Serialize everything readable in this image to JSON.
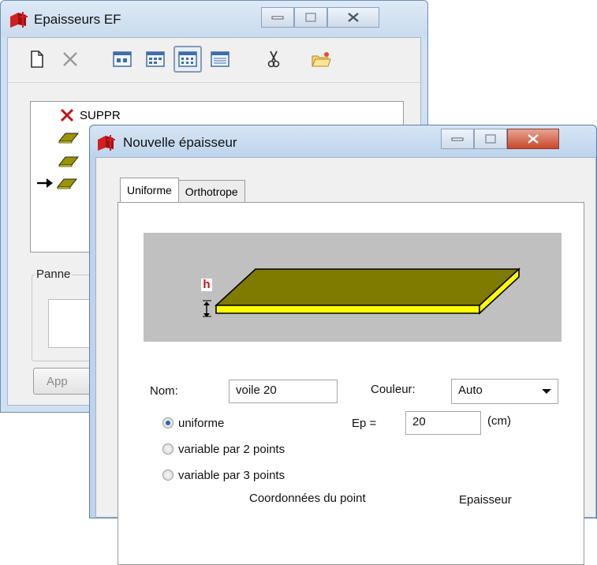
{
  "back_window": {
    "title": "Epaisseurs EF",
    "tree_items": [
      {
        "label": "SUPPR",
        "icon": "delete-x-icon"
      },
      {
        "label": "",
        "icon": "slab-icon"
      },
      {
        "label": "",
        "icon": "slab-icon"
      },
      {
        "label": "",
        "icon": "slab-icon",
        "current": true
      }
    ],
    "panne_label": "Panne",
    "apply_button": "App"
  },
  "front_window": {
    "title": "Nouvelle épaisseur",
    "tabs": [
      {
        "label": "Uniforme",
        "active": true
      },
      {
        "label": "Orthotrope",
        "active": false
      }
    ],
    "preview": {
      "h_label": "h",
      "slab_color": "#7f7a00",
      "slab_edge_color": "#ffff00"
    },
    "form": {
      "nom_label": "Nom:",
      "nom_value": "voile 20",
      "couleur_label": "Couleur:",
      "couleur_value": "Auto",
      "ep_label": "Ep =",
      "ep_value": "20",
      "ep_unit": "(cm)",
      "radios": [
        {
          "label": "uniforme",
          "checked": true
        },
        {
          "label": "variable par 2 points",
          "checked": false
        },
        {
          "label": "variable par 3 points",
          "checked": false
        }
      ],
      "coord_header": "Coordonnées du point",
      "epaisseur_header": "Epaisseur"
    }
  },
  "colors": {
    "titlebar": "#c9dbee",
    "accent": "#2f62b8"
  }
}
